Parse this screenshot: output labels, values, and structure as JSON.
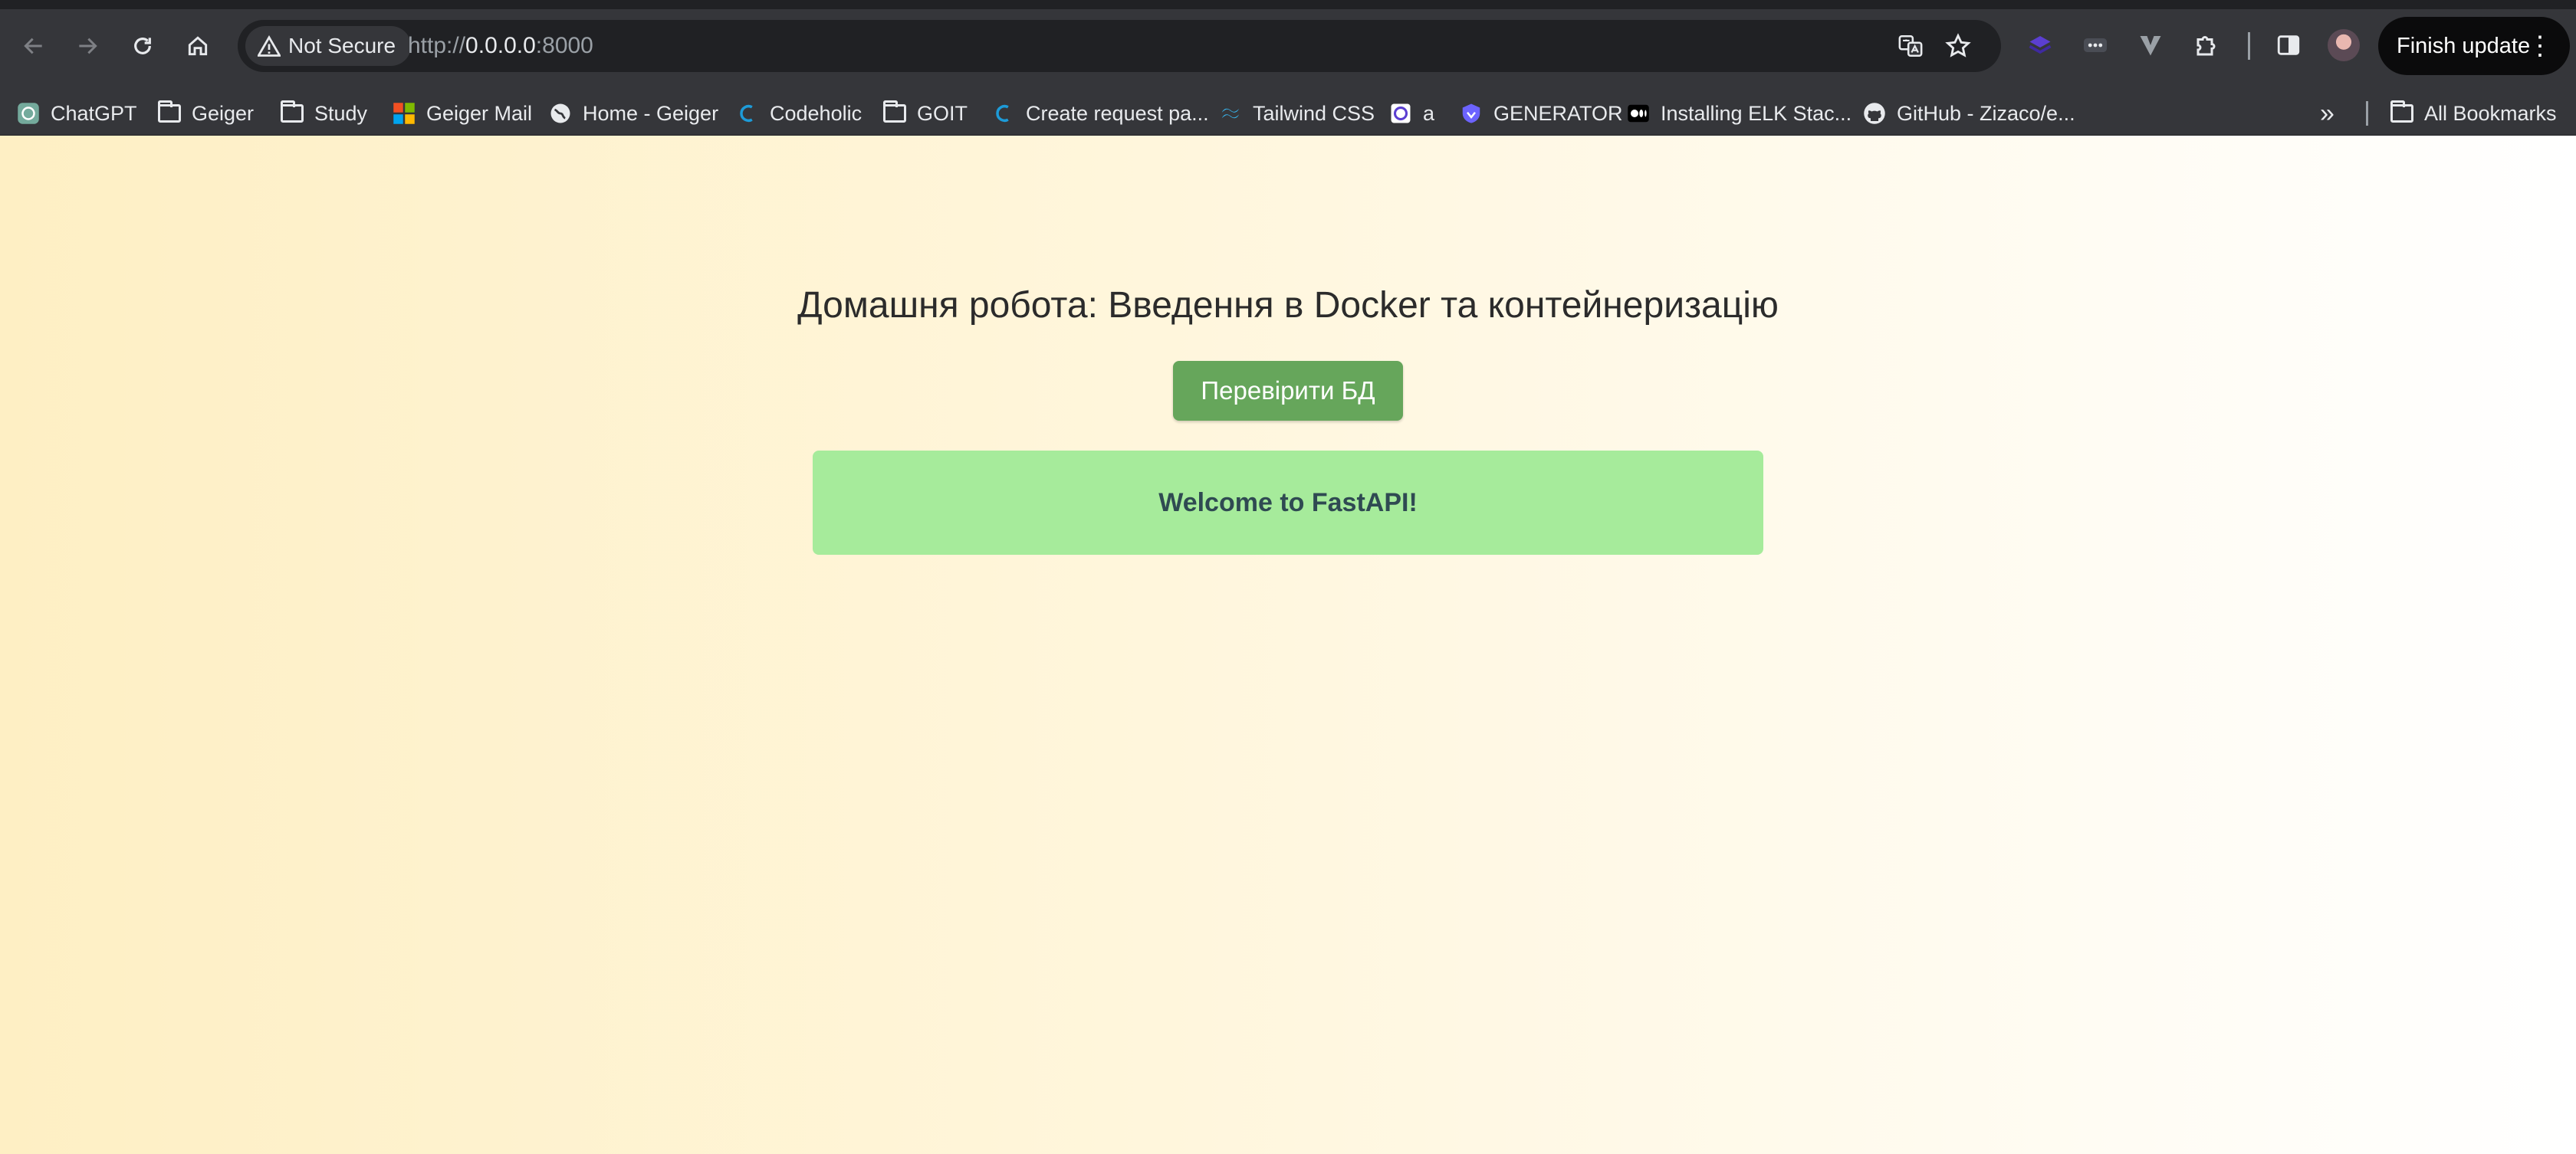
{
  "browser": {
    "security_label": "Not Secure",
    "url_scheme": "http://",
    "url_host": "0.0.0.0",
    "url_port": ":8000",
    "finish_update_label": "Finish update",
    "all_bookmarks_label": "All Bookmarks"
  },
  "bookmarks": [
    {
      "label": "ChatGPT",
      "icon": "chatgpt-icon"
    },
    {
      "label": "Geiger",
      "icon": "folder-icon"
    },
    {
      "label": "Study",
      "icon": "folder-icon"
    },
    {
      "label": "Geiger Mail",
      "icon": "microsoft-icon"
    },
    {
      "label": "Home - Geiger",
      "icon": "globe-icon"
    },
    {
      "label": "Codeholic",
      "icon": "codeholic-icon"
    },
    {
      "label": "GOIT",
      "icon": "folder-icon"
    },
    {
      "label": "Create request pa...",
      "icon": "codeholic-icon"
    },
    {
      "label": "Tailwind CSS",
      "icon": "tailwind-icon"
    },
    {
      "label": "a",
      "icon": "app-icon"
    },
    {
      "label": "GENERATOR",
      "icon": "shield-icon"
    },
    {
      "label": "Installing ELK Stac...",
      "icon": "medium-icon"
    },
    {
      "label": "GitHub - Zizaco/e...",
      "icon": "github-icon"
    }
  ],
  "page": {
    "title": "Домашня робота: Введення в Docker та контейнеризацію",
    "check_button_label": "Перевірити БД",
    "message": "Welcome to FastAPI!"
  },
  "colors": {
    "button": "#66a65b",
    "message_bg": "#a6eb9b",
    "page_gradient_start": "#feefc4",
    "page_gradient_end": "#ffffff"
  }
}
